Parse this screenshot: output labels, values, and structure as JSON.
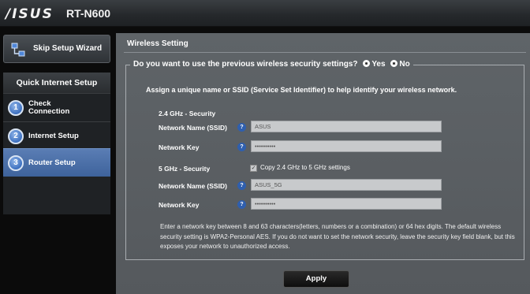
{
  "header": {
    "brand": "/ISUS",
    "model": "RT-N600"
  },
  "sidebar": {
    "skip_label": "Skip Setup Wizard",
    "qis_title": "Quick Internet Setup",
    "steps": [
      {
        "num": "1",
        "label": "Check Connection"
      },
      {
        "num": "2",
        "label": "Internet Setup"
      },
      {
        "num": "3",
        "label": "Router Setup"
      }
    ]
  },
  "main": {
    "title": "Wireless Setting",
    "question": "Do you want to use the previous wireless security settings?",
    "yes_label": "Yes",
    "no_label": "No",
    "selected": "Yes",
    "assign_text": "Assign a unique name or SSID (Service Set Identifier) to help identify your wireless network.",
    "band_24": {
      "section": "2.4 GHz - Security",
      "ssid_label": "Network Name (SSID)",
      "ssid_value": "ASUS",
      "key_label": "Network Key",
      "key_value": "••••••••••"
    },
    "band_5": {
      "section": "5 GHz - Security",
      "copy_label": "Copy 2.4 GHz to 5 GHz settings",
      "copy_checked": true,
      "ssid_label": "Network Name (SSID)",
      "ssid_value": "ASUS_5G",
      "key_label": "Network Key",
      "key_value": "••••••••••"
    },
    "help_glyph": "?",
    "check_glyph": "✓",
    "note": "Enter a network key between 8 and 63 characters(letters, numbers or a combination) or 64 hex digits. The default wireless security setting is WPA2-Personal AES. If you do not want to set the network security, leave the security key field blank, but this exposes your network to unauthorized access.",
    "apply_label": "Apply"
  }
}
